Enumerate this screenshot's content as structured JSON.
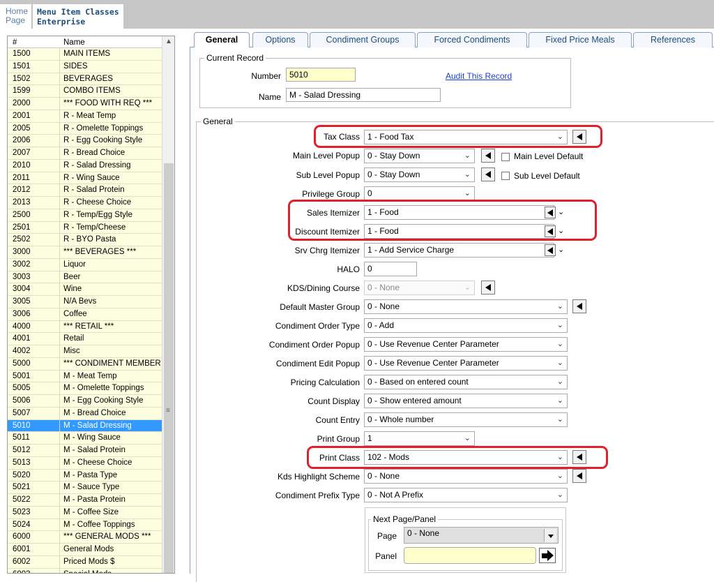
{
  "header": {
    "home_tab_line1": "Home",
    "home_tab_line2": "Page",
    "active_tab_line1": "Menu Item Classes",
    "active_tab_line2": "Enterprise"
  },
  "list": {
    "col_number": "#",
    "col_name": "Name",
    "selected": "5010",
    "rows": [
      [
        "1500",
        "MAIN ITEMS"
      ],
      [
        "1501",
        "SIDES"
      ],
      [
        "1502",
        "BEVERAGES"
      ],
      [
        "1599",
        "COMBO ITEMS"
      ],
      [
        "2000",
        "*** FOOD WITH REQ ***"
      ],
      [
        "2001",
        "R - Meat Temp"
      ],
      [
        "2005",
        "R - Omelette Toppings"
      ],
      [
        "2006",
        "R - Egg Cooking Style"
      ],
      [
        "2007",
        "R - Bread Choice"
      ],
      [
        "2010",
        "R - Salad Dressing"
      ],
      [
        "2011",
        "R - Wing Sauce"
      ],
      [
        "2012",
        "R - Salad Protein"
      ],
      [
        "2013",
        "R - Cheese Choice"
      ],
      [
        "2500",
        "R - Temp/Egg Style"
      ],
      [
        "2501",
        "R - Temp/Cheese"
      ],
      [
        "2502",
        "R - BYO Pasta"
      ],
      [
        "3000",
        "*** BEVERAGES ***"
      ],
      [
        "3002",
        "Liquor"
      ],
      [
        "3003",
        "Beer"
      ],
      [
        "3004",
        "Wine"
      ],
      [
        "3005",
        "N/A Bevs"
      ],
      [
        "3006",
        "Coffee"
      ],
      [
        "4000",
        "*** RETAIL ***"
      ],
      [
        "4001",
        "Retail"
      ],
      [
        "4002",
        "Misc"
      ],
      [
        "5000",
        "*** CONDIMENT MEMBER ***"
      ],
      [
        "5001",
        "M - Meat Temp"
      ],
      [
        "5005",
        "M - Omelette Toppings"
      ],
      [
        "5006",
        "M - Egg Cooking Style"
      ],
      [
        "5007",
        "M - Bread Choice"
      ],
      [
        "5010",
        "M - Salad Dressing"
      ],
      [
        "5011",
        "M - Wing Sauce"
      ],
      [
        "5012",
        "M - Salad Protein"
      ],
      [
        "5013",
        "M - Cheese Choice"
      ],
      [
        "5020",
        "M - Pasta Type"
      ],
      [
        "5021",
        "M - Sauce Type"
      ],
      [
        "5022",
        "M - Pasta Protein"
      ],
      [
        "5023",
        "M - Coffee Size"
      ],
      [
        "5024",
        "M - Coffee Toppings"
      ],
      [
        "6000",
        "*** GENERAL MODS ***"
      ],
      [
        "6001",
        "General Mods"
      ],
      [
        "6002",
        "Priced Mods $"
      ],
      [
        "6003",
        "Special Mods"
      ]
    ]
  },
  "tabs": [
    "General",
    "Options",
    "Condiment Groups",
    "Forced Condiments",
    "Fixed Price Meals",
    "References"
  ],
  "current_record": {
    "title": "Current Record",
    "number_label": "Number",
    "number_value": "5010",
    "name_label": "Name",
    "name_value": "M - Salad Dressing",
    "audit_link": "Audit This Record"
  },
  "general": {
    "title": "General",
    "tax_class": {
      "label": "Tax Class",
      "value": "1 - Food Tax"
    },
    "main_level_popup": {
      "label": "Main Level Popup",
      "value": "0 - Stay Down",
      "check_label": "Main Level Default"
    },
    "sub_level_popup": {
      "label": "Sub Level Popup",
      "value": "0 - Stay Down",
      "check_label": "Sub Level Default"
    },
    "privilege_group": {
      "label": "Privilege Group",
      "value": "0"
    },
    "sales_itemizer": {
      "label": "Sales Itemizer",
      "value": "1 - Food"
    },
    "discount_itemizer": {
      "label": "Discount Itemizer",
      "value": "1 - Food"
    },
    "srv_chrg_itemizer": {
      "label": "Srv Chrg Itemizer",
      "value": "1 - Add Service Charge"
    },
    "halo": {
      "label": "HALO",
      "value": "0"
    },
    "kds_dining_course": {
      "label": "KDS/Dining Course",
      "value": "0 - None"
    },
    "default_master_group": {
      "label": "Default Master Group",
      "value": "0 - None"
    },
    "condiment_order_type": {
      "label": "Condiment Order Type",
      "value": "0 - Add"
    },
    "condiment_order_popup": {
      "label": "Condiment Order Popup",
      "value": "0 - Use Revenue Center Parameter"
    },
    "condiment_edit_popup": {
      "label": "Condiment Edit Popup",
      "value": "0 - Use Revenue Center Parameter"
    },
    "pricing_calculation": {
      "label": "Pricing Calculation",
      "value": "0 - Based on entered count"
    },
    "count_display": {
      "label": "Count Display",
      "value": "0 - Show entered amount"
    },
    "count_entry": {
      "label": "Count Entry",
      "value": "0 - Whole number"
    },
    "print_group": {
      "label": "Print Group",
      "value": "1"
    },
    "print_class": {
      "label": "Print Class",
      "value": "102 - Mods"
    },
    "kds_highlight_scheme": {
      "label": "Kds Highlight Scheme",
      "value": "0 - None"
    },
    "condiment_prefix_type": {
      "label": "Condiment Prefix Type",
      "value": "0 - Not A Prefix"
    }
  },
  "next_page_panel": {
    "title": "Next Page/Panel",
    "page_label": "Page",
    "page_value": "0 - None",
    "panel_label": "Panel",
    "panel_value": ""
  },
  "colors": {
    "highlight": "#e2202c",
    "selected_row": "#3399ff",
    "row_bg": "#fdfde0",
    "link": "#1a3fd1"
  }
}
